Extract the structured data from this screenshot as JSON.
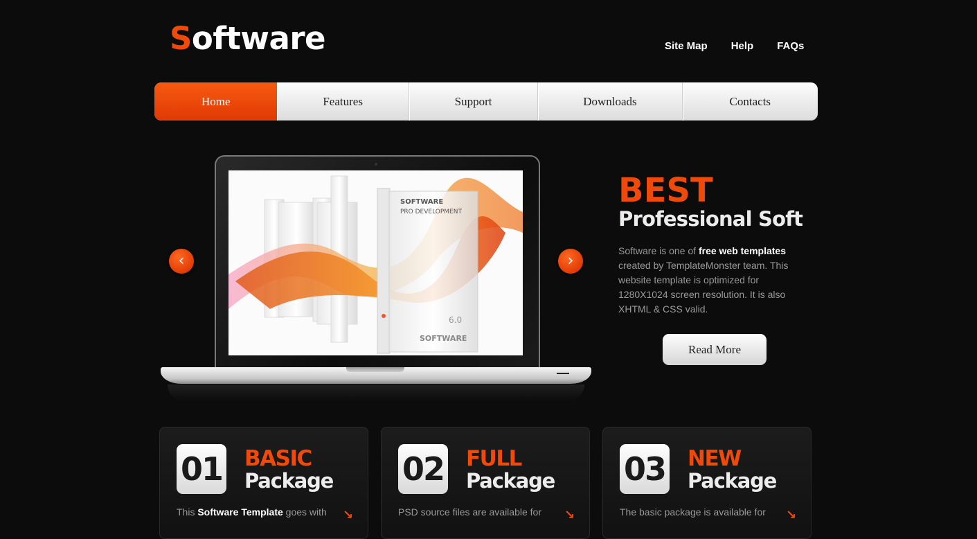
{
  "logo": {
    "first_letter": "S",
    "rest": "oftware"
  },
  "top_links": [
    "Site Map",
    "Help",
    "FAQs"
  ],
  "nav": {
    "items": [
      "Home",
      "Features",
      "Support",
      "Downloads",
      "Contacts"
    ],
    "active": "Home"
  },
  "slider": {
    "prev_icon": "chevron-left",
    "next_icon": "chevron-right",
    "slide_image": "software-pro-development-boxes",
    "box_texts": [
      "SOFTWARE",
      "PRO DEVELOPMENT",
      "SOFTWARE",
      "6.0"
    ]
  },
  "promo": {
    "headline": "BEST",
    "subheadline": "Professional Soft",
    "text_before": "Software is one of ",
    "text_bold": "free web templates",
    "text_after": " created by TemplateMonster team. This website template is optimized for 1280X1024 screen resolution. It is also XHTML & CSS valid.",
    "button": "Read More"
  },
  "packages": [
    {
      "number": "01",
      "kind": "BASIC",
      "name": "Package",
      "desc_before": "This ",
      "desc_bold": "Software Template",
      "desc_after": " goes with"
    },
    {
      "number": "02",
      "kind": "FULL",
      "name": "Package",
      "desc_before": "PSD source files are available for",
      "desc_bold": "",
      "desc_after": ""
    },
    {
      "number": "03",
      "kind": "NEW",
      "name": "Package",
      "desc_before": "The basic package is available for",
      "desc_bold": "",
      "desc_after": ""
    }
  ],
  "colors": {
    "accent": "#f04a0a",
    "background": "#0c0c0c"
  }
}
